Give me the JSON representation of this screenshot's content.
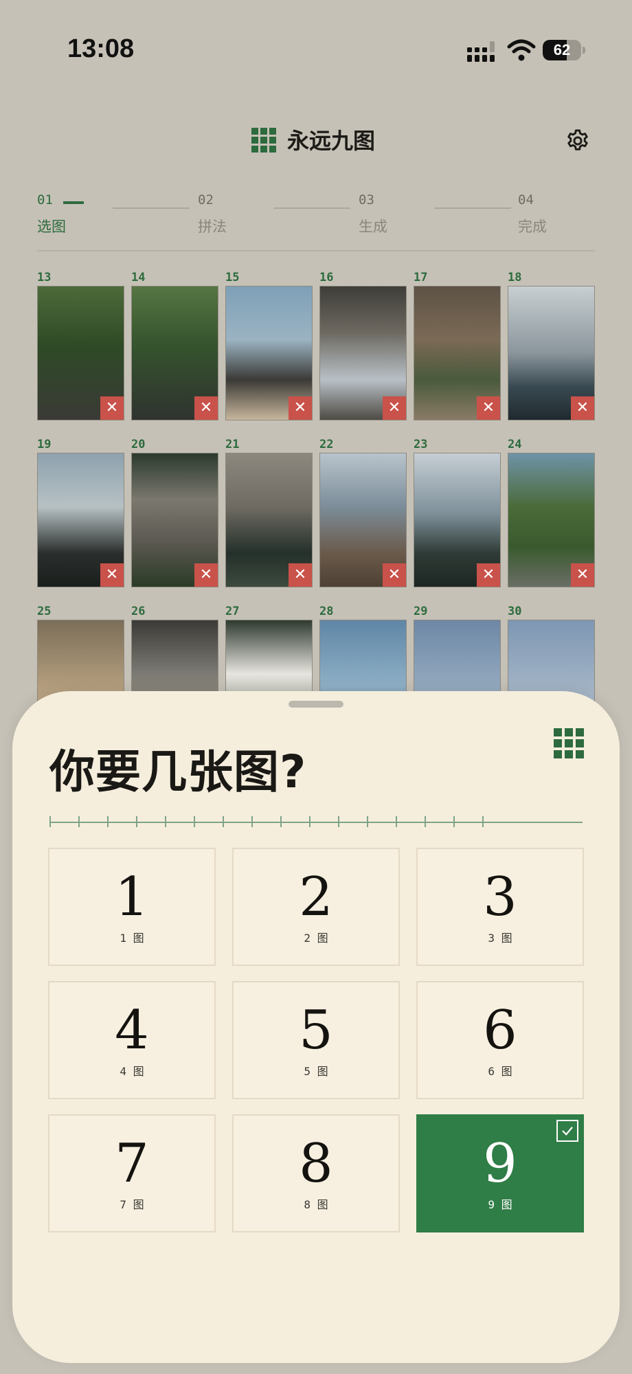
{
  "status_bar": {
    "time": "13:08",
    "battery": "62",
    "battery_level": 0.62
  },
  "header": {
    "title": "永远九图",
    "logo_icon": "grid-3x3-icon",
    "settings_icon": "gear-icon"
  },
  "stepper": {
    "steps": [
      {
        "num": "01",
        "label": "选图",
        "active": true
      },
      {
        "num": "02",
        "label": "拼法",
        "active": false
      },
      {
        "num": "03",
        "label": "生成",
        "active": false
      },
      {
        "num": "04",
        "label": "完成",
        "active": false
      }
    ]
  },
  "photos": [
    {
      "num": "13",
      "remove": "✕"
    },
    {
      "num": "14",
      "remove": "✕"
    },
    {
      "num": "15",
      "remove": "✕"
    },
    {
      "num": "16",
      "remove": "✕"
    },
    {
      "num": "17",
      "remove": "✕"
    },
    {
      "num": "18",
      "remove": "✕"
    },
    {
      "num": "19",
      "remove": "✕"
    },
    {
      "num": "20",
      "remove": "✕"
    },
    {
      "num": "21",
      "remove": "✕"
    },
    {
      "num": "22",
      "remove": "✕"
    },
    {
      "num": "23",
      "remove": "✕"
    },
    {
      "num": "24",
      "remove": "✕"
    },
    {
      "num": "25"
    },
    {
      "num": "26"
    },
    {
      "num": "27"
    },
    {
      "num": "28"
    },
    {
      "num": "29"
    },
    {
      "num": "30"
    }
  ],
  "sheet": {
    "title": "你要几张图?",
    "options": [
      {
        "value": "1",
        "sub": "1 图"
      },
      {
        "value": "2",
        "sub": "2 图"
      },
      {
        "value": "3",
        "sub": "3 图"
      },
      {
        "value": "4",
        "sub": "4 图"
      },
      {
        "value": "5",
        "sub": "5 图"
      },
      {
        "value": "6",
        "sub": "6 图"
      },
      {
        "value": "7",
        "sub": "7 图"
      },
      {
        "value": "8",
        "sub": "8 图"
      },
      {
        "value": "9",
        "sub": "9 图",
        "selected": true
      }
    ]
  },
  "colors": {
    "accent": "#2d6b3e",
    "selected": "#2f7d47",
    "remove": "#c9524a",
    "sheet_bg": "#f5eedd"
  }
}
